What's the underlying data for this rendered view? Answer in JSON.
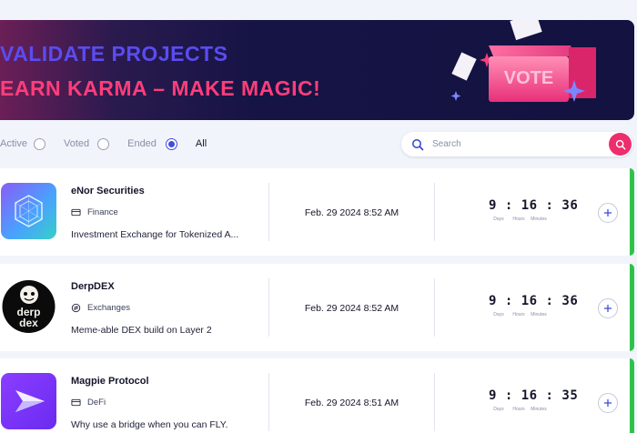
{
  "banner": {
    "line1": "VALIDATE PROJECTS",
    "line2": "EARN KARMA – MAKE MAGIC!",
    "box_label": "VOTE"
  },
  "filters": [
    {
      "label": "Active",
      "selected": false
    },
    {
      "label": "Voted",
      "selected": false
    },
    {
      "label": "Ended",
      "selected": false
    },
    {
      "label": "All",
      "selected": true
    }
  ],
  "search": {
    "placeholder": "Search",
    "value": ""
  },
  "timer_units": {
    "days": "Days",
    "hours": "Hours",
    "minutes": "Minutes"
  },
  "projects": [
    {
      "name": "eNor Securities",
      "category": "Finance",
      "description": "Investment Exchange for Tokenized A...",
      "date": "Feb. 29 2024 8:52 AM",
      "days": "9",
      "hours": "16",
      "minutes": "36",
      "status_color": "#2fc24a"
    },
    {
      "name": "DerpDEX",
      "category": "Exchanges",
      "description": "Meme-able DEX build on Layer 2",
      "date": "Feb. 29 2024 8:52 AM",
      "days": "9",
      "hours": "16",
      "minutes": "36",
      "status_color": "#2fc24a",
      "logo_text_1": "derp",
      "logo_text_2": "dex"
    },
    {
      "name": "Magpie Protocol",
      "category": "DeFi",
      "description": "Why use a bridge when you can FLY.",
      "date": "Feb. 29 2024 8:51 AM",
      "days": "9",
      "hours": "16",
      "minutes": "35",
      "status_color": "#2fc24a"
    }
  ],
  "colors": {
    "accent": "#3f4de3",
    "pink": "#ec2d6e",
    "active_green": "#2fc24a"
  }
}
